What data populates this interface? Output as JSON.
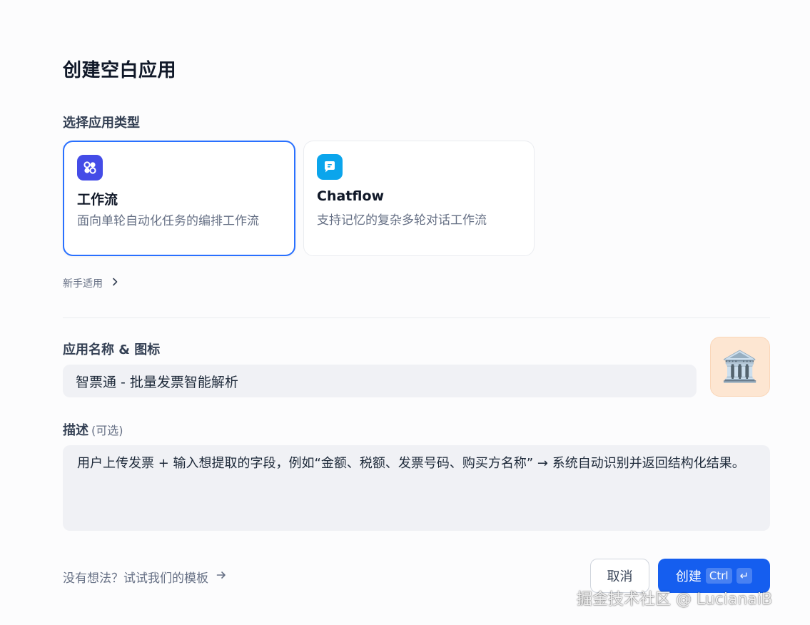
{
  "page_title": "创建空白应用",
  "type_section": {
    "label": "选择应用类型",
    "cards": [
      {
        "title": "工作流",
        "desc": "面向单轮自动化任务的编排工作流",
        "icon": "workflow-icon",
        "color": "#444ce7",
        "selected": true
      },
      {
        "title": "Chatflow",
        "desc": "支持记忆的复杂多轮对话工作流",
        "icon": "chat-bubble-icon",
        "color": "#0ba5ec",
        "selected": false
      }
    ],
    "beginner_label": "新手适用"
  },
  "name_section": {
    "label": "应用名称 & 图标",
    "value": "智票通 - 批量发票智能解析",
    "icon_emoji": "🏛️",
    "icon_bg": "#fde6d2"
  },
  "desc_section": {
    "label": "描述",
    "optional": "(可选)",
    "value": "用户上传发票 + 输入想提取的字段，例如“金额、税额、发票号码、购买方名称” → 系统自动识别并返回结构化结果。"
  },
  "footer": {
    "template_link": "没有想法？试试我们的模板",
    "cancel_label": "取消",
    "create_label": "创建",
    "shortcut_key": "Ctrl",
    "enter_symbol": "↵"
  },
  "watermark": "掘金技术社区 @ LucianaiB",
  "colors": {
    "accent": "#155eef",
    "selected_border": "#2970ff"
  }
}
